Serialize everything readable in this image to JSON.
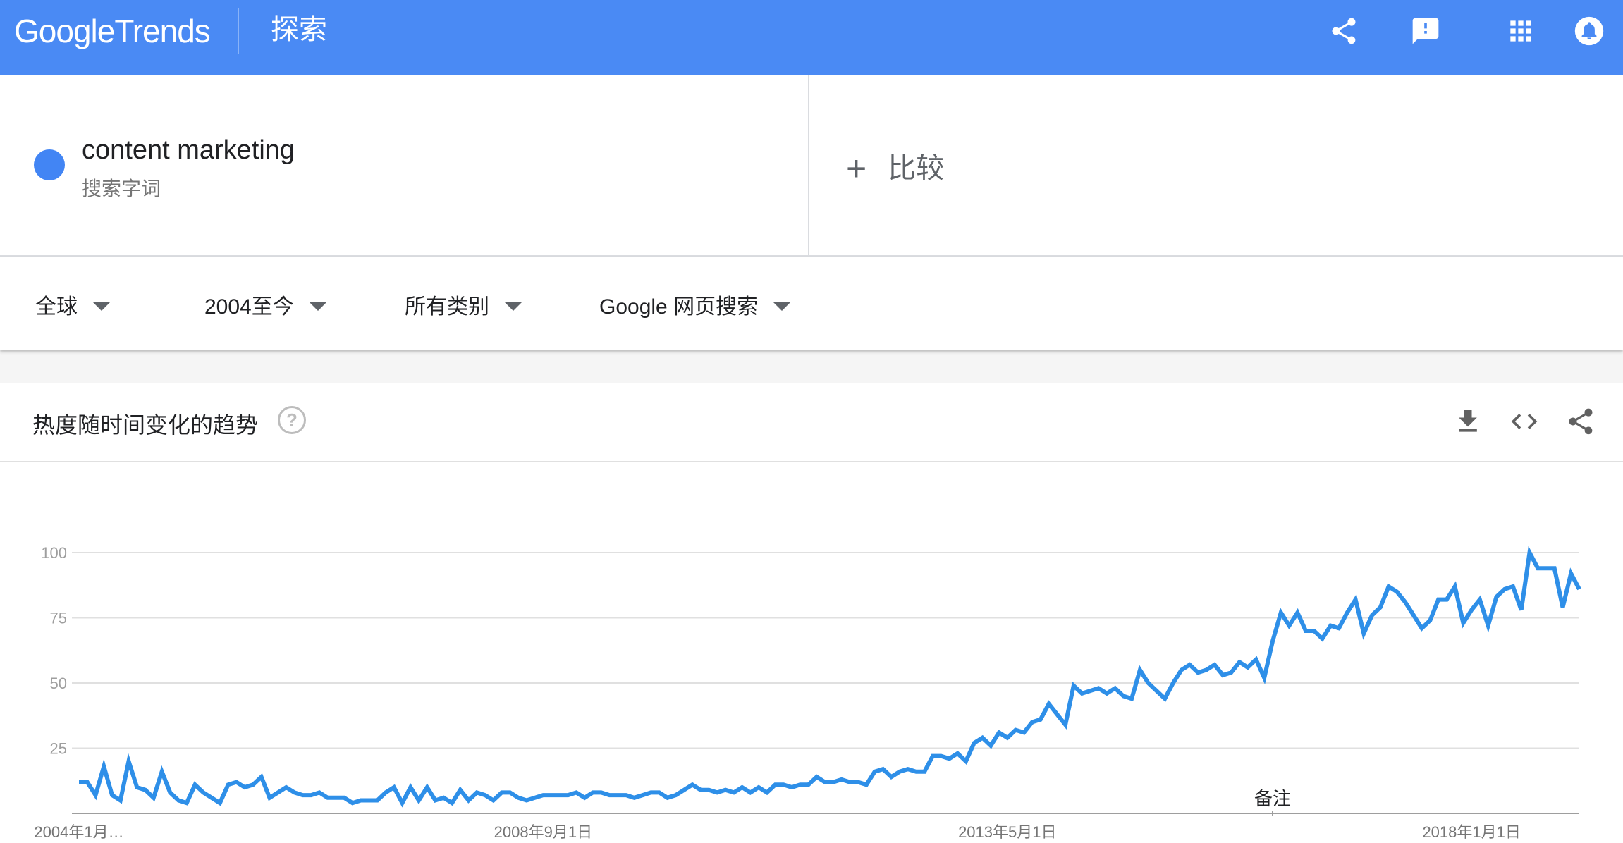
{
  "header": {
    "logo_google": "Google",
    "logo_trends": "Trends",
    "section": "探索"
  },
  "term": {
    "name": "content marketing",
    "type": "搜索字词",
    "color": "#4285f4"
  },
  "compare_label": "比较",
  "filters": {
    "region": "全球",
    "time": "2004至今",
    "category": "所有类别",
    "search_type": "Google 网页搜索"
  },
  "card": {
    "title": "热度随时间变化的趋势",
    "help": "?"
  },
  "colors": {
    "header": "#4a8af4",
    "line": "#2e8fe8",
    "grid": "#e0e0e0"
  },
  "chart_data": {
    "type": "line",
    "ylim": [
      0,
      100
    ],
    "yticks": [
      25,
      50,
      75,
      100
    ],
    "x_tick_labels": [
      "2004年1月…",
      "2008年9月1日",
      "2013年5月1日",
      "2018年1月1日"
    ],
    "x_tick_index": [
      0,
      56,
      112,
      168
    ],
    "annotation": {
      "label": "备注",
      "index": 144
    },
    "series": [
      {
        "values": [
          12,
          12,
          7,
          18,
          7,
          5,
          20,
          10,
          9,
          6,
          16,
          8,
          5,
          4,
          11,
          8,
          6,
          4,
          11,
          12,
          10,
          11,
          14,
          6,
          8,
          10,
          8,
          7,
          7,
          8,
          6,
          6,
          6,
          4,
          5,
          5,
          5,
          8,
          10,
          4,
          10,
          5,
          10,
          5,
          6,
          4,
          9,
          5,
          8,
          7,
          5,
          8,
          8,
          6,
          5,
          6,
          7,
          7,
          7,
          7,
          8,
          6,
          8,
          8,
          7,
          7,
          7,
          6,
          7,
          8,
          8,
          6,
          7,
          9,
          11,
          9,
          9,
          8,
          9,
          8,
          10,
          8,
          10,
          8,
          11,
          11,
          10,
          11,
          11,
          14,
          12,
          12,
          13,
          12,
          12,
          11,
          16,
          17,
          14,
          16,
          17,
          16,
          16,
          22,
          22,
          21,
          23,
          20,
          27,
          29,
          26,
          31,
          29,
          32,
          31,
          35,
          36,
          42,
          38,
          34,
          49,
          46,
          47,
          48,
          46,
          48,
          45,
          44,
          55,
          50,
          47,
          44,
          50,
          55,
          57,
          54,
          55,
          57,
          53,
          54,
          58,
          56,
          59,
          52,
          66,
          77,
          72,
          77,
          70,
          70,
          67,
          72,
          71,
          77,
          82,
          69,
          76,
          79,
          87,
          85,
          81,
          76,
          71,
          74,
          82,
          82,
          87,
          73,
          78,
          82,
          72,
          83,
          86,
          87,
          78,
          100,
          94,
          94,
          94,
          79,
          92,
          86
        ]
      }
    ]
  }
}
